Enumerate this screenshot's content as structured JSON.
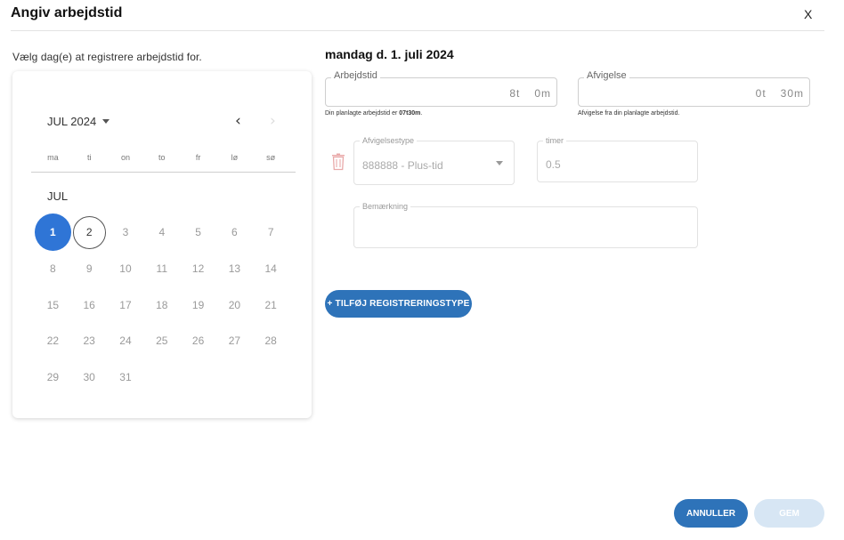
{
  "dialog": {
    "title": "Angiv arbejdstid",
    "close_label": "X",
    "instruction": "Vælg dag(e) at registrere arbejdstid for."
  },
  "calendar": {
    "month_select": "JUL 2024",
    "prev_icon": "chevron-left-icon",
    "next_icon": "chevron-right-icon",
    "weekdays": [
      "ma",
      "ti",
      "on",
      "to",
      "fr",
      "lø",
      "sø"
    ],
    "month_label": "JUL",
    "days": [
      "1",
      "2",
      "3",
      "4",
      "5",
      "6",
      "7",
      "8",
      "9",
      "10",
      "11",
      "12",
      "13",
      "14",
      "15",
      "16",
      "17",
      "18",
      "19",
      "20",
      "21",
      "22",
      "23",
      "24",
      "25",
      "26",
      "27",
      "28",
      "29",
      "30",
      "31"
    ],
    "selected_day": "1",
    "today_day": "2"
  },
  "form": {
    "date_heading": "mandag d. 1. juli 2024",
    "work_time": {
      "label": "Arbejdstid",
      "hours": "8t",
      "minutes": "0m",
      "helper_prefix": "Din planlagte arbejdstid er ",
      "helper_value": "07t30m",
      "helper_suffix": "."
    },
    "deviation": {
      "label": "Afvigelse",
      "hours": "0t",
      "minutes": "30m",
      "helper": "Afvigelse fra din planlagte arbejdstid."
    },
    "deviation_type": {
      "label": "Afvigelsestype",
      "value": "888888 - Plus-tid"
    },
    "hours_field": {
      "label": "timer",
      "value": "0.5"
    },
    "note": {
      "label": "Bemærkning",
      "value": ""
    },
    "add_button": "+ TILFØJ REGISTRERINGSTYPE"
  },
  "footer": {
    "cancel_label": "ANNULLER",
    "save_label": "GEM"
  },
  "colors": {
    "primary": "#2e73b9",
    "selected_day": "#2f75d6",
    "disabled_button": "#d7e6f4",
    "trash_icon": "#e9a9a9"
  }
}
